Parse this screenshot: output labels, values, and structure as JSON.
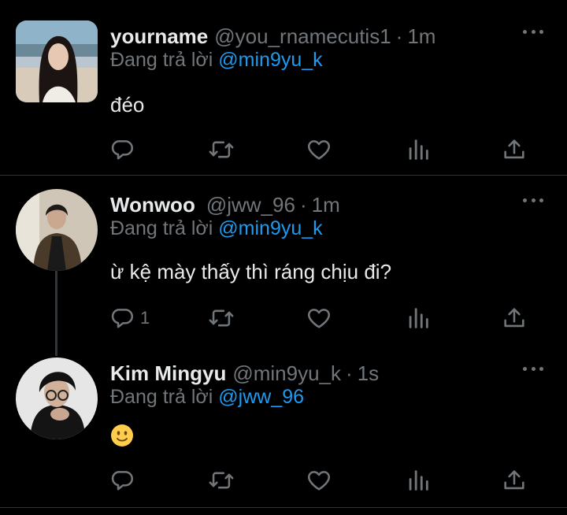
{
  "tweets": [
    {
      "name": "yourname",
      "handle": "@you_rnamecutis1",
      "sep": "·",
      "time": "1m",
      "reply_prefix": "Đang trả lời ",
      "reply_mention": "@min9yu_k",
      "text": "đéo",
      "reply_count": ""
    },
    {
      "name": "Wonwoo",
      "handle": "@jww_96",
      "sep": "·",
      "time": "1m",
      "reply_prefix": "Đang trả lời ",
      "reply_mention": "@min9yu_k",
      "text": "ừ kệ mày thấy thì ráng chịu đi?",
      "reply_count": "1"
    },
    {
      "name": "Kim Mingyu",
      "handle": "@min9yu_k",
      "sep": "·",
      "time": "1s",
      "reply_prefix": "Đang trả lời ",
      "reply_mention": "@jww_96",
      "text": "",
      "emoji": "slightly-smiling-face-emoji",
      "reply_count": ""
    }
  ],
  "icons": {
    "reply": "reply-icon",
    "retweet": "retweet-icon",
    "like": "heart-icon",
    "views": "views-icon",
    "share": "share-icon",
    "more": "more-icon"
  },
  "colors": {
    "background": "#000000",
    "text": "#e7e9ea",
    "muted": "#71767b",
    "accent": "#1d9bf0",
    "divider": "#2f3336"
  }
}
